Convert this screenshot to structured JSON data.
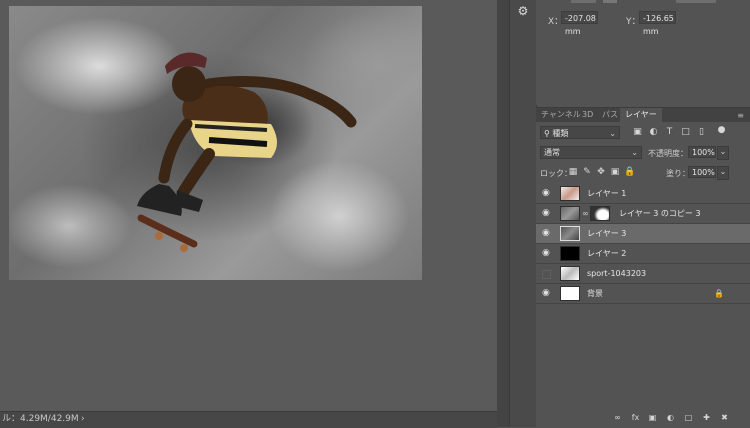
{
  "canvas": {
    "description_icon": "skateboarder-photo-over-clouds"
  },
  "status_bar": {
    "doc_size": "ル：4.29M/42.9M",
    "arrow": "›"
  },
  "properties": {
    "x_label": "X：",
    "x_value": "-207.08 mm",
    "y_label": "Y：",
    "y_value": "-126.65 mm"
  },
  "layers_panel": {
    "tabs": [
      "チャンネル",
      "3D",
      "パス",
      "レイヤー"
    ],
    "active_tab": "レイヤー",
    "filter_label": "種類",
    "blend_mode": "通常",
    "opacity_label": "不透明度：",
    "opacity_value": "100%",
    "lock_label": "ロック：",
    "fill_label": "塗り：",
    "fill_value": "100%",
    "layers": [
      {
        "name": "レイヤー 1",
        "visible": true,
        "selected": false
      },
      {
        "name": "レイヤー 3 のコピー 3",
        "visible": true,
        "selected": false
      },
      {
        "name": "レイヤー 3",
        "visible": true,
        "selected": true
      },
      {
        "name": "レイヤー 2",
        "visible": true,
        "selected": false
      },
      {
        "name": "sport-1043203",
        "visible": false,
        "selected": false
      },
      {
        "name": "背景",
        "visible": true,
        "selected": false,
        "locked": true
      }
    ],
    "bottom_icons": [
      "link-icon",
      "fx-icon",
      "mask-icon",
      "adjustment-icon",
      "folder-icon",
      "new-layer-icon",
      "trash-icon"
    ],
    "fx_text": "fx"
  },
  "colors": {
    "panel_bg": "#535353",
    "selected_row": "#6a6a6a"
  }
}
